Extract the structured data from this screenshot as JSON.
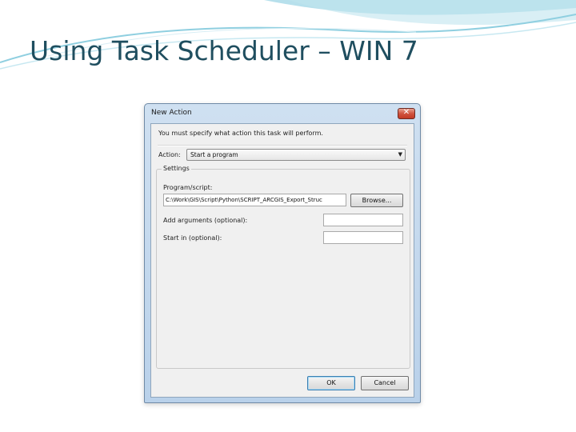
{
  "slide": {
    "title": "Using Task Scheduler – WIN 7"
  },
  "dialog": {
    "title": "New Action",
    "close_label": "✕",
    "intro": "You must specify what action this task will perform.",
    "action_label": "Action:",
    "action_value": "Start a program",
    "settings_label": "Settings",
    "program_label": "Program/script:",
    "program_value": "C:\\Work\\GIS\\Script\\Python\\SCRIPT_ARCGIS_Export_Struc",
    "browse_label": "Browse...",
    "arguments_label": "Add arguments (optional):",
    "arguments_value": "",
    "startin_label": "Start in (optional):",
    "startin_value": "",
    "ok_label": "OK",
    "cancel_label": "Cancel"
  }
}
